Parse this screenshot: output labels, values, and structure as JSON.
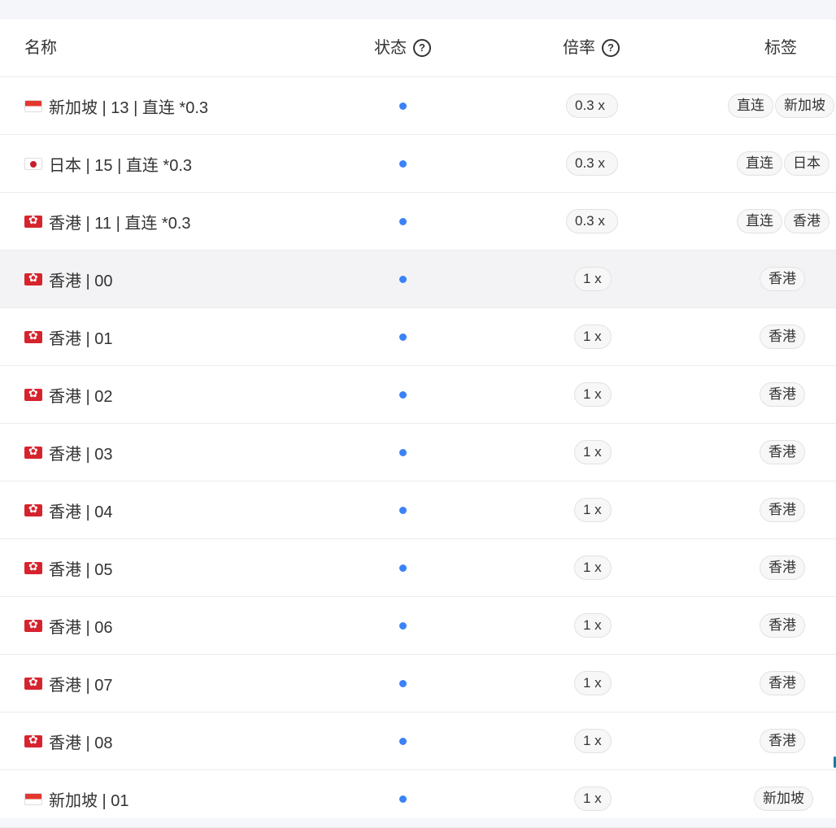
{
  "table": {
    "headers": {
      "name": "名称",
      "status": "状态",
      "rate": "倍率",
      "tags": "标签"
    },
    "rows": [
      {
        "flag": "sg",
        "name": "新加坡 | 13 | 直连 *0.3",
        "rate": "0.3 x",
        "tags": [
          "直连",
          "新加坡"
        ]
      },
      {
        "flag": "jp",
        "name": "日本 | 15 | 直连 *0.3",
        "rate": "0.3 x",
        "tags": [
          "直连",
          "日本"
        ]
      },
      {
        "flag": "hk",
        "name": "香港 | 11 | 直连 *0.3",
        "rate": "0.3 x",
        "tags": [
          "直连",
          "香港"
        ]
      },
      {
        "flag": "hk",
        "name": "香港 | 00",
        "rate": "1 x",
        "tags": [
          "香港"
        ]
      },
      {
        "flag": "hk",
        "name": "香港 | 01",
        "rate": "1 x",
        "tags": [
          "香港"
        ]
      },
      {
        "flag": "hk",
        "name": "香港 | 02",
        "rate": "1 x",
        "tags": [
          "香港"
        ]
      },
      {
        "flag": "hk",
        "name": "香港 | 03",
        "rate": "1 x",
        "tags": [
          "香港"
        ]
      },
      {
        "flag": "hk",
        "name": "香港 | 04",
        "rate": "1 x",
        "tags": [
          "香港"
        ]
      },
      {
        "flag": "hk",
        "name": "香港 | 05",
        "rate": "1 x",
        "tags": [
          "香港"
        ]
      },
      {
        "flag": "hk",
        "name": "香港 | 06",
        "rate": "1 x",
        "tags": [
          "香港"
        ]
      },
      {
        "flag": "hk",
        "name": "香港 | 07",
        "rate": "1 x",
        "tags": [
          "香港"
        ]
      },
      {
        "flag": "hk",
        "name": "香港 | 08",
        "rate": "1 x",
        "tags": [
          "香港"
        ]
      },
      {
        "flag": "sg",
        "name": "新加坡 | 01",
        "rate": "1 x",
        "tags": [
          "新加坡"
        ]
      }
    ]
  },
  "colors": {
    "status_online": "#3b82f6",
    "hover_row": "#f3f3f5"
  },
  "icons": {
    "help": "question-circle-icon",
    "status": "status-dot-icon"
  }
}
